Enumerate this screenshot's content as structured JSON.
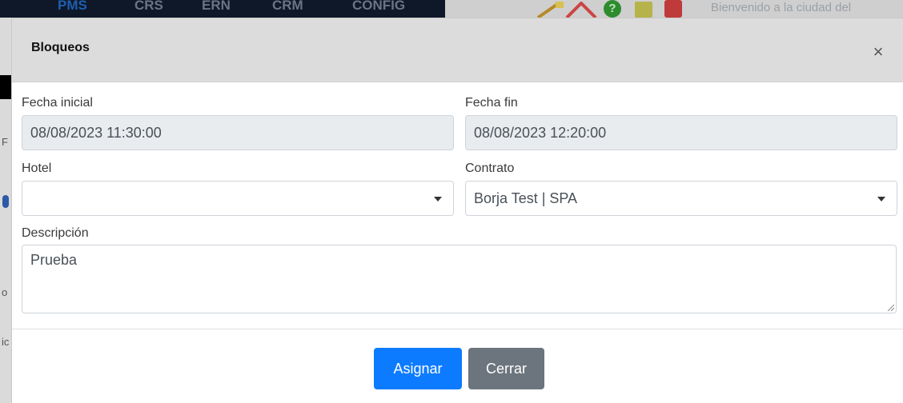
{
  "background": {
    "nav_items": [
      "PMS",
      "CRS",
      "ERN",
      "CRM",
      "CONFIG"
    ],
    "welcome_text": "Bienvenido a la ciudad del",
    "left_fragments": [
      "F",
      "o",
      "ic"
    ]
  },
  "modal": {
    "title": "Bloqueos",
    "close_glyph": "×",
    "fields": {
      "fecha_inicial": {
        "label": "Fecha inicial",
        "value": "08/08/2023 11:30:00"
      },
      "fecha_fin": {
        "label": "Fecha fin",
        "value": "08/08/2023 12:20:00"
      },
      "hotel": {
        "label": "Hotel",
        "value": ""
      },
      "contrato": {
        "label": "Contrato",
        "value": "Borja Test | SPA"
      },
      "descripcion": {
        "label": "Descripción",
        "value": "Prueba"
      }
    },
    "buttons": {
      "assign": "Asignar",
      "close": "Cerrar"
    }
  },
  "colors": {
    "primary": "#0d7bff",
    "secondary": "#6c757d",
    "header_bg": "#dcdcdc",
    "readonly_bg": "#e9ecef"
  }
}
